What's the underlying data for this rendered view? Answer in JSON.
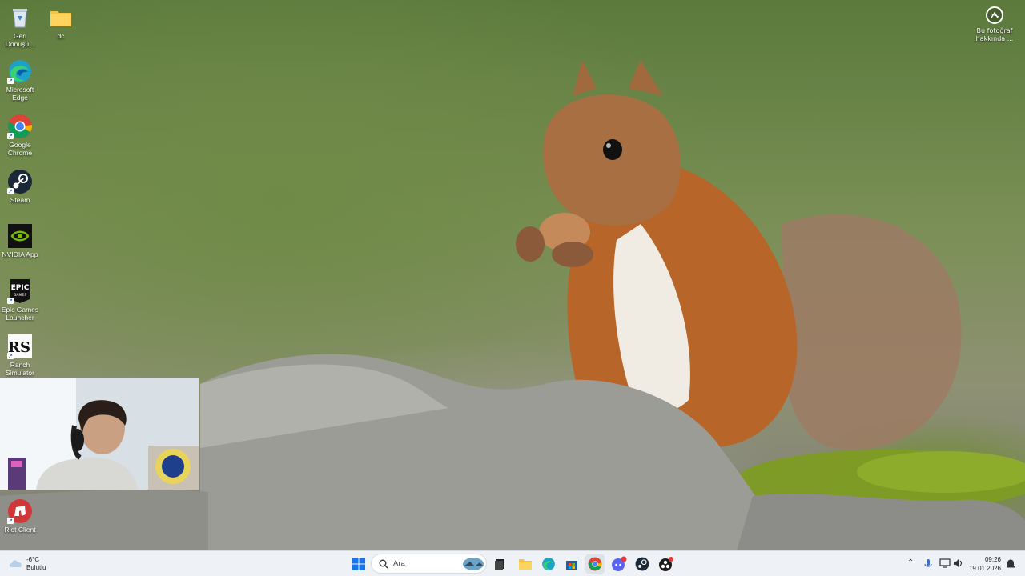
{
  "desktop": {
    "icons": [
      {
        "name": "recycle-bin",
        "label": "Geri Dönüşü..."
      },
      {
        "name": "dc-folder",
        "label": "dc"
      },
      {
        "name": "microsoft-edge",
        "label": "Microsoft Edge"
      },
      {
        "name": "google-chrome",
        "label": "Google Chrome"
      },
      {
        "name": "steam",
        "label": "Steam"
      },
      {
        "name": "nvidia-app",
        "label": "NVIDIA App"
      },
      {
        "name": "epic-games-launcher",
        "label": "Epic Games Launcher"
      },
      {
        "name": "ranch-simulator",
        "label": "Ranch Simulator"
      },
      {
        "name": "riot-client",
        "label": "Riot Client"
      }
    ],
    "photo_info": {
      "label": "Bu fotoğraf hakkında ..."
    }
  },
  "taskbar": {
    "weather": {
      "temp": "-6°C",
      "condition": "Bulutlu"
    },
    "search": {
      "placeholder": "Ara"
    },
    "clock": {
      "time": "09:26",
      "date": "19.01.2026"
    }
  },
  "colors": {
    "taskbar_bg": "#eef1f5",
    "windows_blue": "#1a73e8"
  }
}
